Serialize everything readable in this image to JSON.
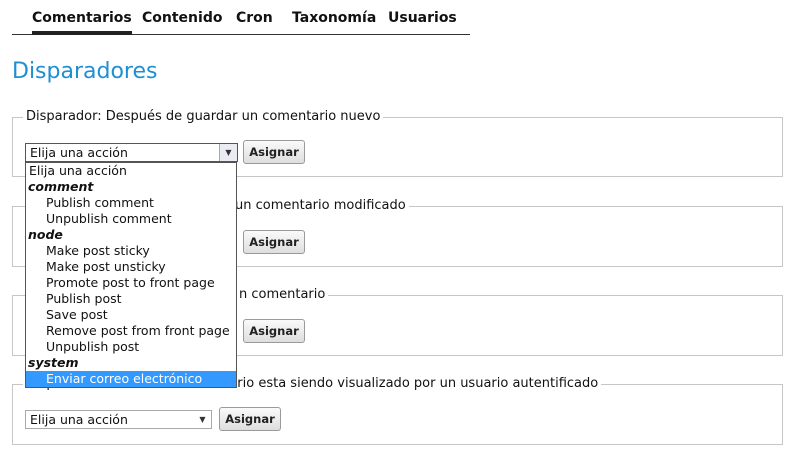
{
  "tabs": [
    {
      "label": "Comentarios",
      "active": true
    },
    {
      "label": "Contenido"
    },
    {
      "label": "Cron"
    },
    {
      "label": "Taxonomía"
    },
    {
      "label": "Usuarios"
    }
  ],
  "page_title": "Disparadores",
  "assign_label": "Asignar",
  "triggers": [
    {
      "legend": "Disparador: Después de guardar un comentario nuevo",
      "selected": "Elija una acción"
    },
    {
      "legend": "un comentario modificado"
    },
    {
      "legend": "n comentario"
    },
    {
      "legend": "Disparador: Cuando un comentario esta siendo visualizado por un usuario autentificado",
      "selected": "Elija una acción"
    }
  ],
  "dropdown": {
    "placeholder": "Elija una acción",
    "groups": [
      {
        "label": "comment",
        "options": [
          "Publish comment",
          "Unpublish comment"
        ]
      },
      {
        "label": "node",
        "options": [
          "Make post sticky",
          "Make post unsticky",
          "Promote post to front page",
          "Publish post",
          "Save post",
          "Remove post from front page",
          "Unpublish post"
        ]
      },
      {
        "label": "system",
        "options": [
          "Enviar correo electrónico"
        ]
      }
    ],
    "highlighted": "Enviar correo electrónico"
  },
  "colors": {
    "title": "#1e8fd2",
    "highlight": "#3399ff"
  }
}
